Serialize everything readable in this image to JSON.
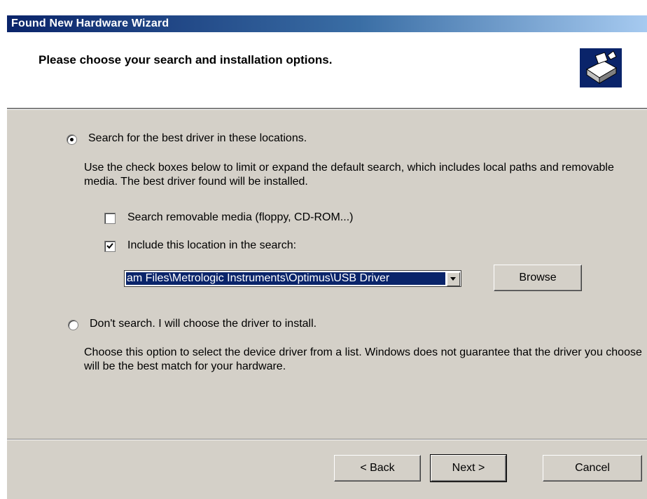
{
  "window": {
    "title": "Found New Hardware Wizard"
  },
  "header": {
    "heading": "Please choose your search and installation options.",
    "icon": "hardware-wizard-icon"
  },
  "options": {
    "search": {
      "label": "Search for the best driver in these locations.",
      "selected": true,
      "description": "Use the check boxes below to limit or expand the default search, which includes local paths and removable media. The best driver found will be installed.",
      "removable_media": {
        "label": "Search removable media (floppy, CD-ROM...)",
        "checked": false
      },
      "include_location": {
        "label": "Include this location in the search:",
        "checked": true
      },
      "location_value": "am Files\\Metrologic Instruments\\Optimus\\USB Driver",
      "browse_label": "Browse"
    },
    "dont_search": {
      "label": "Don't search. I will choose the driver to install.",
      "selected": false,
      "description": "Choose this option to select the device driver from a list.  Windows does not guarantee that the driver you choose will be the best match for your hardware."
    }
  },
  "footer": {
    "back_label": "< Back",
    "next_label": "Next >",
    "cancel_label": "Cancel"
  }
}
